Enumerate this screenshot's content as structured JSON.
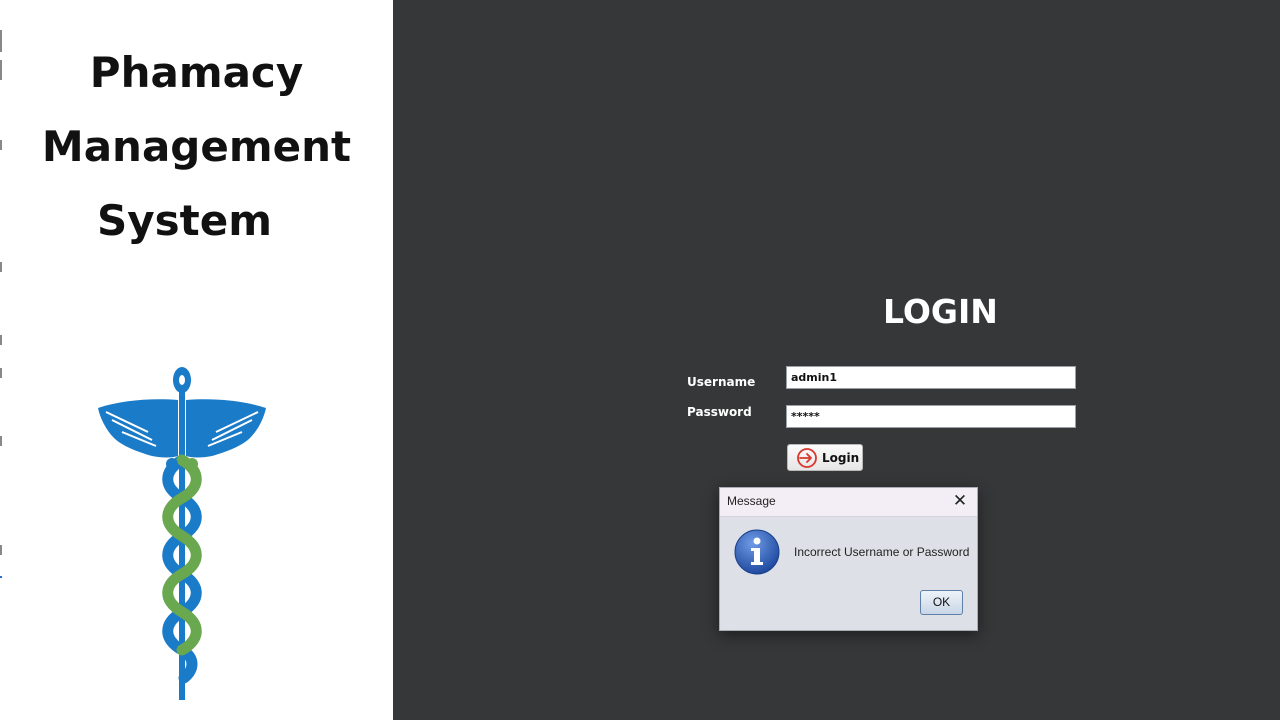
{
  "app": {
    "title_lines": [
      "Phamacy",
      "Management",
      "System"
    ]
  },
  "login": {
    "heading": "LOGIN",
    "username_label": "Username",
    "username_value": "admin1",
    "password_label": "Password",
    "password_value": "*****",
    "login_button_label": "Login",
    "login_button_icon": "login-arrow-icon"
  },
  "dialog": {
    "title": "Message",
    "close_glyph": "✕",
    "message": "Incorrect Username or Password",
    "ok_label": "OK",
    "icon": "info-icon"
  },
  "colors": {
    "background": "#353738",
    "left_panel": "#ffffff",
    "caduceus_blue": "#1a7bc9",
    "caduceus_green": "#6aa84f",
    "info_blue": "#2f5fb3"
  }
}
